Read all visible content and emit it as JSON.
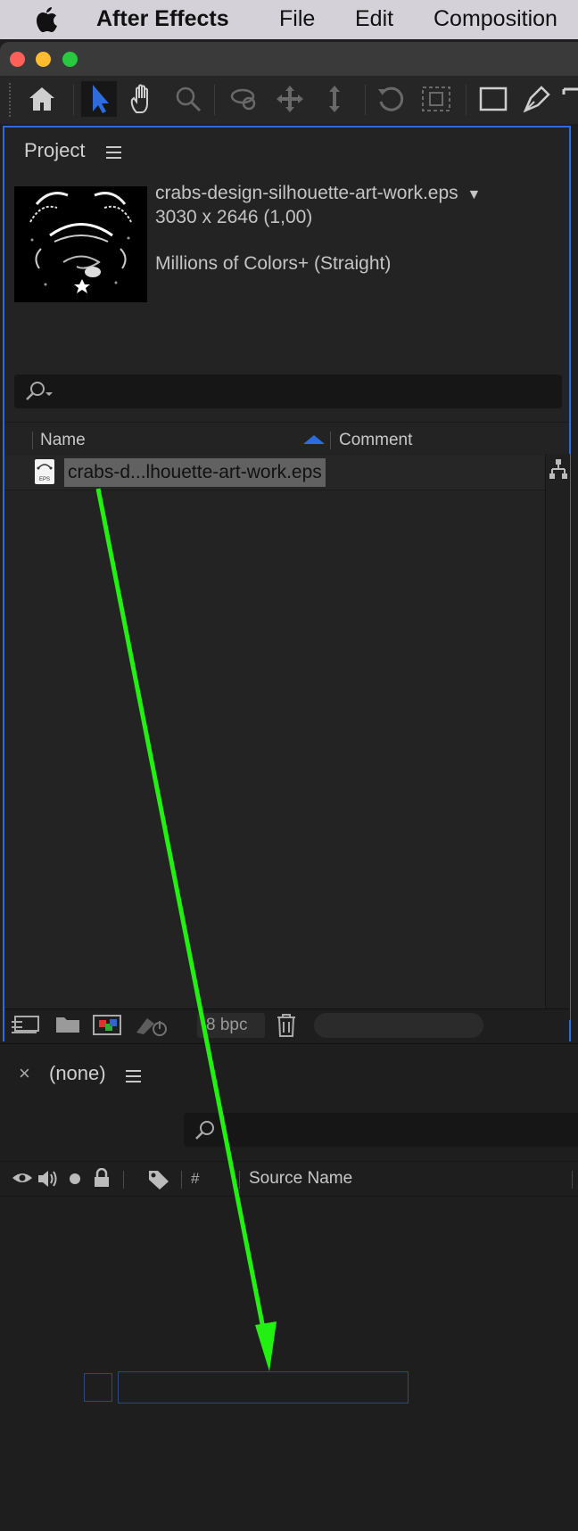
{
  "menubar": {
    "apple_icon": "apple-logo-icon",
    "app_name": "After Effects",
    "items": [
      "File",
      "Edit",
      "Composition"
    ]
  },
  "window": {
    "traffic_lights": {
      "close": "#fe5f57",
      "minimize": "#febc2e",
      "zoom": "#28c840"
    }
  },
  "toolbar": {
    "tools": [
      "home-icon",
      "selection-tool-icon",
      "hand-tool-icon",
      "zoom-tool-icon",
      "orbit-camera-icon",
      "pan-camera-icon",
      "dolly-camera-icon",
      "rotation-tool-icon",
      "pan-behind-icon",
      "rectangle-tool-icon",
      "pen-tool-icon",
      "type-tool-icon"
    ],
    "active_tool": "selection-tool-icon",
    "accent": "#2d6cdf"
  },
  "project": {
    "title": "Project",
    "info": {
      "filename": "crabs-design-silhouette-art-work.eps",
      "dimensions": "3030 x 2646 (1,00)",
      "colors": "Millions of Colors+ (Straight)"
    },
    "search_placeholder": "",
    "columns": {
      "name": "Name",
      "comment": "Comment"
    },
    "items": [
      {
        "name": "crabs-d...lhouette-art-work.eps",
        "type_badge": "EPS"
      }
    ],
    "footer": {
      "bpc": "8 bpc",
      "icons": [
        "interpret-footage-icon",
        "new-folder-icon",
        "new-composition-icon",
        "flowchart-icon",
        "trash-icon"
      ]
    }
  },
  "timeline": {
    "close_symbol": "×",
    "title": "(none)",
    "columns": {
      "hash": "#",
      "source_name": "Source Name"
    },
    "column_icons": [
      "eye-icon",
      "speaker-icon",
      "solo-icon",
      "lock-icon",
      "label-tag-icon"
    ]
  },
  "annotation": {
    "arrow_color": "#22f010"
  }
}
